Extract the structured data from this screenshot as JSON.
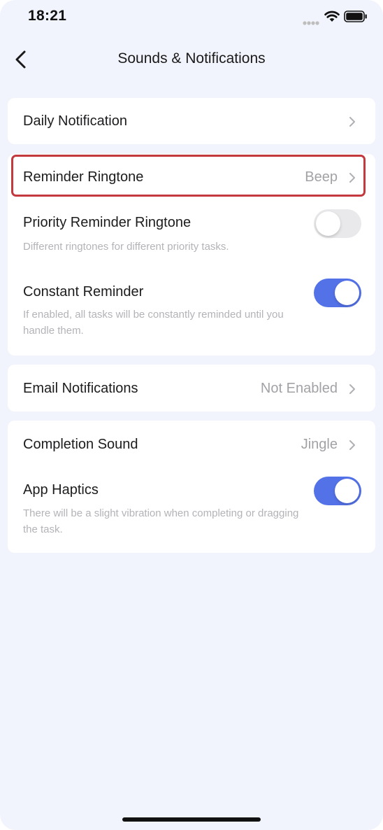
{
  "status_bar": {
    "time": "18:21"
  },
  "nav": {
    "title": "Sounds & Notifications"
  },
  "sections": {
    "daily": {
      "title": "Daily Notification"
    },
    "reminder": {
      "ringtone_title": "Reminder Ringtone",
      "ringtone_value": "Beep",
      "priority_title": "Priority Reminder Ringtone",
      "priority_desc": "Different ringtones for different priority tasks.",
      "priority_enabled": false,
      "constant_title": "Constant Reminder",
      "constant_desc": "If enabled, all tasks will be constantly reminded until you handle them.",
      "constant_enabled": true
    },
    "email": {
      "title": "Email Notifications",
      "value": "Not Enabled"
    },
    "sound": {
      "completion_title": "Completion Sound",
      "completion_value": "Jingle",
      "haptics_title": "App Haptics",
      "haptics_desc": "There will be a slight vibration when completing or dragging the task.",
      "haptics_enabled": true
    }
  },
  "colors": {
    "accent": "#5472e8",
    "highlight": "#c3393e",
    "background": "#f2f4fd"
  },
  "icons": [
    "signal-icon",
    "wifi-icon",
    "battery-icon",
    "back-chevron-icon",
    "chevron-right-icon"
  ]
}
